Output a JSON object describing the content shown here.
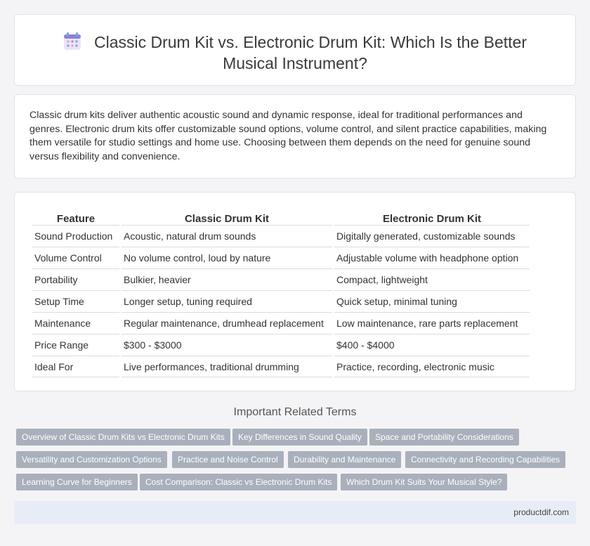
{
  "header": {
    "icon": "calendar-grid-icon",
    "title": "Classic Drum Kit vs. Electronic Drum Kit: Which Is the Better Musical Instrument?"
  },
  "intro": {
    "text": "Classic drum kits deliver authentic acoustic sound and dynamic response, ideal for traditional performances and genres. Electronic drum kits offer customizable sound options, volume control, and silent practice capabilities, making them versatile for studio settings and home use. Choosing between them depends on the need for genuine sound versus flexibility and convenience."
  },
  "comparison": {
    "headers": [
      "Feature",
      "Classic Drum Kit",
      "Electronic Drum Kit"
    ],
    "rows": [
      [
        "Sound Production",
        "Acoustic, natural drum sounds",
        "Digitally generated, customizable sounds"
      ],
      [
        "Volume Control",
        "No volume control, loud by nature",
        "Adjustable volume with headphone option"
      ],
      [
        "Portability",
        "Bulkier, heavier",
        "Compact, lightweight"
      ],
      [
        "Setup Time",
        "Longer setup, tuning required",
        "Quick setup, minimal tuning"
      ],
      [
        "Maintenance",
        "Regular maintenance, drumhead replacement",
        "Low maintenance, rare parts replacement"
      ],
      [
        "Price Range",
        "$300 - $3000",
        "$400 - $4000"
      ],
      [
        "Ideal For",
        "Live performances, traditional drumming",
        "Practice, recording, electronic music"
      ]
    ]
  },
  "related": {
    "title": "Important Related Terms",
    "tags": [
      "Overview of Classic Drum Kits vs Electronic Drum Kits",
      "Key Differences in Sound Quality",
      "Space and Portability Considerations",
      "Versatility and Customization Options",
      "Practice and Noise Control",
      "Durability and Maintenance",
      "Connectivity and Recording Capabilities",
      "Learning Curve for Beginners",
      "Cost Comparison: Classic vs Electronic Drum Kits",
      "Which Drum Kit Suits Your Musical Style?"
    ]
  },
  "footer": {
    "site": "productdif.com"
  },
  "colors": {
    "tag_bg": "#a9b0bb",
    "footer_bg": "#e7ecf6",
    "page_bg": "#f4f4f6"
  }
}
